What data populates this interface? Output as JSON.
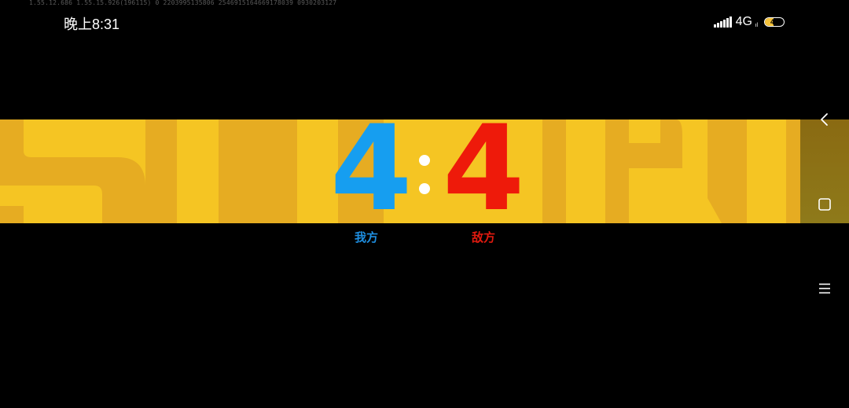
{
  "debug": {
    "text": "1.55.12.686  1.55.15.926(196115)  0  2203995135806  2546915164669178039  0930203127"
  },
  "status_bar": {
    "time": "晚上8:31",
    "network": "4G",
    "network_sub": "ıl",
    "battery_level": "47",
    "battery_fraction": 0.47
  },
  "scoreboard": {
    "our_score": "4",
    "enemy_score": "4",
    "our_label": "我方",
    "enemy_label": "敌方"
  },
  "colors": {
    "banner": "#f5c523",
    "our_team": "#169ef0",
    "enemy_team": "#ee1a0a"
  },
  "nav": {
    "icons": [
      "back-icon",
      "home-icon",
      "menu-icon"
    ]
  }
}
